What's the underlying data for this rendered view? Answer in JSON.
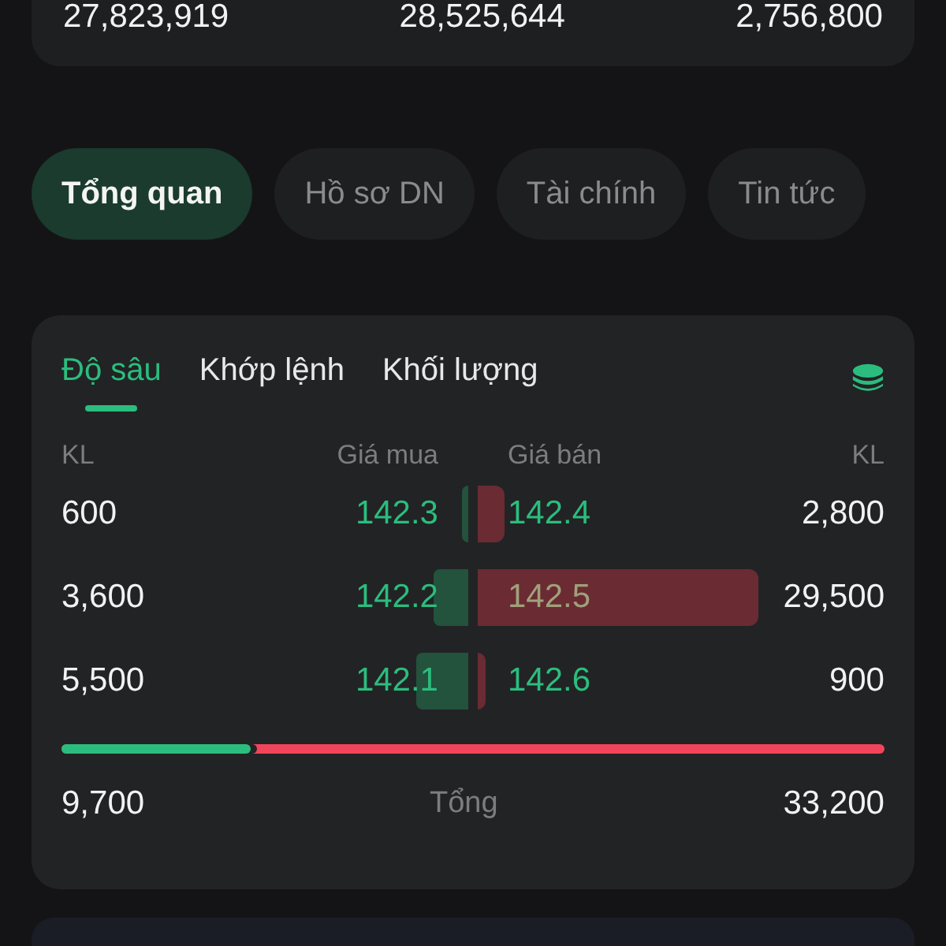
{
  "summary": {
    "values": [
      "27,823,919",
      "28,525,644",
      "2,756,800"
    ]
  },
  "tabs": [
    {
      "label": "Tổng quan",
      "selected": true
    },
    {
      "label": "Hồ sơ DN",
      "selected": false
    },
    {
      "label": "Tài chính",
      "selected": false
    },
    {
      "label": "Tin tức",
      "selected": false
    }
  ],
  "depth": {
    "tabs": [
      {
        "label": "Độ sâu",
        "selected": true
      },
      {
        "label": "Khớp lệnh",
        "selected": false
      },
      {
        "label": "Khối lượng",
        "selected": false
      }
    ],
    "columns": [
      "KL",
      "Giá mua",
      "Giá bán",
      "KL"
    ],
    "rows": [
      {
        "bid": {
          "volume": "600",
          "price": "142.3"
        },
        "ask": {
          "price": "142.4",
          "volume": "2,800"
        }
      },
      {
        "bid": {
          "volume": "3,600",
          "price": "142.2"
        },
        "ask": {
          "price": "142.5",
          "volume": "29,500"
        }
      },
      {
        "bid": {
          "volume": "5,500",
          "price": "142.1"
        },
        "ask": {
          "price": "142.6",
          "volume": "900"
        }
      }
    ],
    "balance": {
      "level": 0.23
    },
    "total": {
      "bid": "9,700",
      "label": "Tổng",
      "ask": "33,200"
    }
  }
}
